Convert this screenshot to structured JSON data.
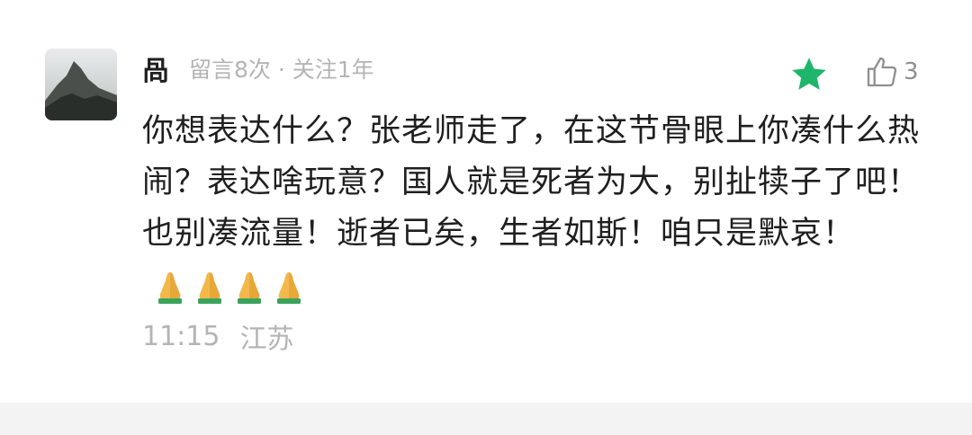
{
  "comment": {
    "username": "咼",
    "meta": "留言8次 · 关注1年",
    "text": "你想表达什么？张老师走了，在这节骨眼上你凑什么热闹？表达啥玩意？国人就是死者为大，别扯犊子了吧！也别凑流量！逝者已矣，生者如斯！咱只是默哀！",
    "emojis": "🙏🙏🙏🙏",
    "time": "11:15",
    "location": "江苏",
    "like_count": "3",
    "icons": {
      "star": "star-icon",
      "like": "thumbs-up-icon",
      "prayer": "folded-hands-icon"
    },
    "colors": {
      "star": "#1fb56a",
      "text": "#1f1f1f",
      "meta": "#b4b4b4"
    }
  }
}
